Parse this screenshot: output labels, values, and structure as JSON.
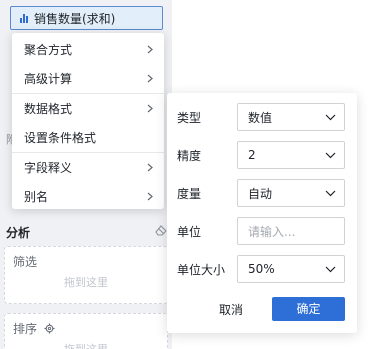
{
  "field": {
    "label": "销售数量(求和)",
    "icon": "bar-chart-icon"
  },
  "peek": {
    "left_letter": "附"
  },
  "analysis": {
    "title": "分析",
    "clear_icon": "eraser-icon"
  },
  "filter_box": {
    "label": "筛选",
    "hint": "拖到这里"
  },
  "sort_box": {
    "label": "排序",
    "hint": "拖到这里",
    "settings_icon": "gear-icon"
  },
  "menu": {
    "items": [
      {
        "label": "聚合方式",
        "has_submenu": true
      },
      {
        "label": "高级计算",
        "has_submenu": true
      },
      {
        "label": "数据格式",
        "has_submenu": true
      },
      {
        "label": "设置条件格式",
        "has_submenu": false
      },
      {
        "label": "字段释义",
        "has_submenu": true
      },
      {
        "label": "别名",
        "has_submenu": true
      }
    ]
  },
  "format_panel": {
    "type": {
      "label": "类型",
      "value": "数值"
    },
    "precision": {
      "label": "精度",
      "value": "2"
    },
    "magnitude": {
      "label": "度量",
      "value": "自动"
    },
    "unit": {
      "label": "单位",
      "placeholder": "请输入..."
    },
    "unit_size": {
      "label": "单位大小",
      "value": "50%"
    },
    "cancel_label": "取消",
    "ok_label": "确定"
  },
  "colors": {
    "accent": "#2d6fd6",
    "chip_bg": "#e2eef9",
    "chip_border": "#5b8ad3",
    "panel_bg": "#f0f1f4"
  }
}
